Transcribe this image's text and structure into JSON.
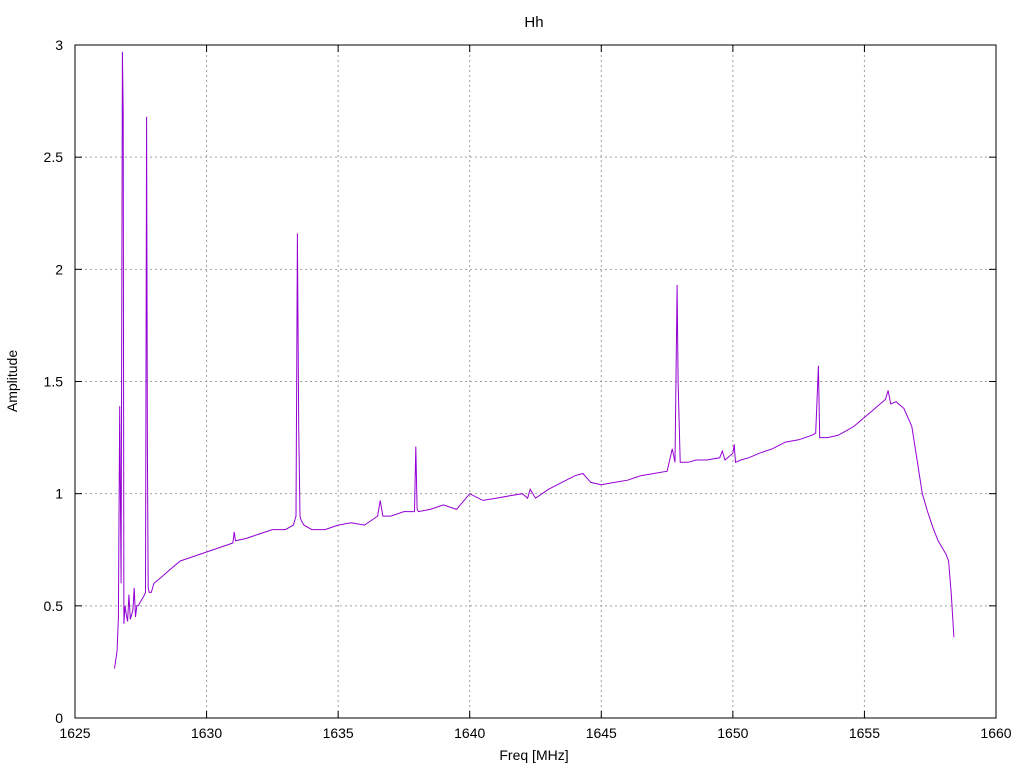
{
  "chart_data": {
    "type": "line",
    "title": "Hh",
    "xlabel": "Freq [MHz]",
    "ylabel": "Amplitude",
    "xlim": [
      1625,
      1660
    ],
    "ylim": [
      0,
      3
    ],
    "xticks": [
      1625,
      1630,
      1635,
      1640,
      1645,
      1650,
      1655,
      1660
    ],
    "yticks": [
      0,
      0.5,
      1,
      1.5,
      2,
      2.5,
      3
    ],
    "ytick_labels": [
      "0",
      "0.5",
      "1",
      "1.5",
      "2",
      "2.5",
      "3"
    ],
    "grid": true,
    "line_color": "#9400d3",
    "series": [
      {
        "x": [
          1626.5,
          1626.6,
          1626.65,
          1626.7,
          1626.75,
          1626.8,
          1626.83,
          1626.86,
          1626.9,
          1626.95,
          1627.0,
          1627.05,
          1627.1,
          1627.15,
          1627.2,
          1627.25,
          1627.3,
          1627.35,
          1627.4,
          1627.5,
          1627.6,
          1627.68,
          1627.72,
          1627.75,
          1627.78,
          1627.82,
          1627.9,
          1628.0,
          1628.3,
          1628.6,
          1629.0,
          1629.5,
          1630.0,
          1630.5,
          1631.0,
          1631.05,
          1631.1,
          1631.5,
          1632.0,
          1632.5,
          1633.0,
          1633.3,
          1633.4,
          1633.45,
          1633.5,
          1633.55,
          1633.6,
          1633.7,
          1634.0,
          1634.5,
          1635.0,
          1635.5,
          1636.0,
          1636.5,
          1636.6,
          1636.7,
          1637.0,
          1637.5,
          1637.9,
          1637.95,
          1638.0,
          1638.05,
          1638.5,
          1639.0,
          1639.5,
          1640.0,
          1640.5,
          1641.0,
          1641.5,
          1642.0,
          1642.2,
          1642.3,
          1642.5,
          1643.0,
          1643.5,
          1644.0,
          1644.3,
          1644.6,
          1645.0,
          1645.5,
          1646.0,
          1646.5,
          1647.0,
          1647.5,
          1647.7,
          1647.8,
          1647.88,
          1647.92,
          1648.0,
          1648.3,
          1648.6,
          1649.0,
          1649.5,
          1649.6,
          1649.7,
          1650.0,
          1650.05,
          1650.1,
          1650.3,
          1650.6,
          1651.0,
          1651.5,
          1652.0,
          1652.5,
          1653.0,
          1653.15,
          1653.25,
          1653.3,
          1653.4,
          1653.6,
          1654.0,
          1654.3,
          1654.6,
          1655.0,
          1655.3,
          1655.6,
          1655.8,
          1655.9,
          1656.0,
          1656.2,
          1656.5,
          1656.8,
          1657.0,
          1657.2,
          1657.4,
          1657.6,
          1657.8,
          1658.0,
          1658.1,
          1658.2,
          1658.3,
          1658.4
        ],
        "y": [
          0.22,
          0.3,
          0.45,
          1.39,
          0.6,
          2.97,
          2.7,
          0.42,
          0.5,
          0.46,
          0.43,
          0.55,
          0.44,
          0.46,
          0.48,
          0.58,
          0.45,
          0.5,
          0.5,
          0.52,
          0.54,
          0.56,
          2.68,
          1.2,
          0.58,
          0.56,
          0.56,
          0.6,
          0.63,
          0.66,
          0.7,
          0.72,
          0.74,
          0.76,
          0.78,
          0.83,
          0.79,
          0.8,
          0.82,
          0.84,
          0.84,
          0.86,
          0.9,
          2.16,
          1.3,
          0.9,
          0.88,
          0.86,
          0.84,
          0.84,
          0.86,
          0.87,
          0.86,
          0.9,
          0.97,
          0.9,
          0.9,
          0.92,
          0.92,
          1.21,
          0.93,
          0.92,
          0.93,
          0.95,
          0.93,
          1.0,
          0.97,
          0.98,
          0.99,
          1.0,
          0.98,
          1.02,
          0.98,
          1.02,
          1.05,
          1.08,
          1.09,
          1.05,
          1.04,
          1.05,
          1.06,
          1.08,
          1.09,
          1.1,
          1.2,
          1.14,
          1.93,
          1.5,
          1.14,
          1.14,
          1.15,
          1.15,
          1.16,
          1.19,
          1.15,
          1.18,
          1.22,
          1.14,
          1.15,
          1.16,
          1.18,
          1.2,
          1.23,
          1.24,
          1.26,
          1.27,
          1.57,
          1.25,
          1.25,
          1.25,
          1.26,
          1.28,
          1.3,
          1.34,
          1.37,
          1.4,
          1.42,
          1.46,
          1.4,
          1.41,
          1.38,
          1.3,
          1.15,
          1.0,
          0.92,
          0.85,
          0.79,
          0.75,
          0.73,
          0.7,
          0.55,
          0.36
        ]
      }
    ]
  }
}
